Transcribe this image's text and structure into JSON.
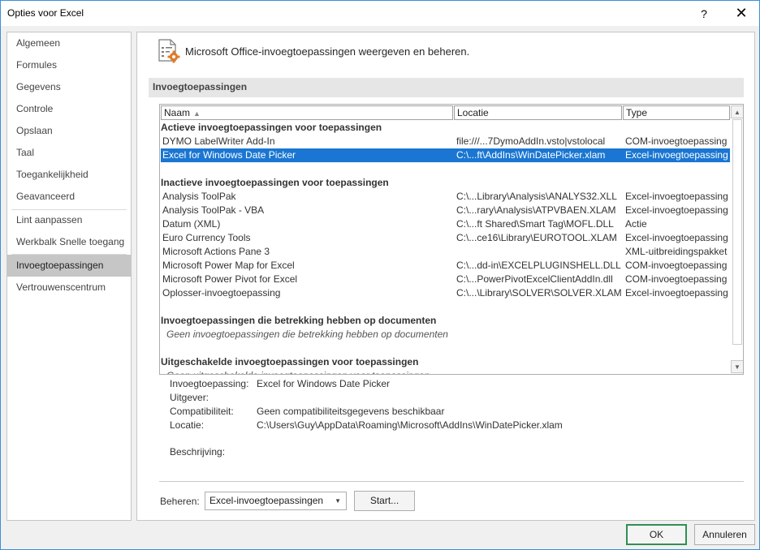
{
  "window": {
    "title": "Opties voor Excel",
    "help_glyph": "?",
    "close_glyph": "✕"
  },
  "nav": {
    "items": [
      {
        "label": "Algemeen"
      },
      {
        "label": "Formules"
      },
      {
        "label": "Gegevens"
      },
      {
        "label": "Controle"
      },
      {
        "label": "Opslaan"
      },
      {
        "label": "Taal"
      },
      {
        "label": "Toegankelijkheid"
      },
      {
        "label": "Geavanceerd"
      },
      {
        "label": "Lint aanpassen"
      },
      {
        "label": "Werkbalk Snelle toegang"
      },
      {
        "label": "Invoegtoepassingen",
        "selected": true
      },
      {
        "label": "Vertrouwenscentrum"
      }
    ]
  },
  "content": {
    "header_icon": "addins-gear-icon",
    "header_text": "Microsoft Office-invoegtoepassingen weergeven en beheren.",
    "section_title": "Invoegtoepassingen"
  },
  "list": {
    "columns": {
      "name": "Naam",
      "name_sort": "▲",
      "location": "Locatie",
      "type": "Type"
    },
    "rows": [
      {
        "kind": "group",
        "name": "Actieve invoegtoepassingen voor toepassingen"
      },
      {
        "kind": "item",
        "name": "DYMO LabelWriter Add-In",
        "location": "file:///...7DymoAddIn.vsto|vstolocal",
        "type": "COM-invoegtoepassing"
      },
      {
        "kind": "item",
        "name": "Excel for Windows Date Picker",
        "location": "C:\\...ft\\AddIns\\WinDatePicker.xlam",
        "type": "Excel-invoegtoepassing",
        "selected": true
      },
      {
        "kind": "spacer"
      },
      {
        "kind": "group",
        "name": "Inactieve invoegtoepassingen voor toepassingen"
      },
      {
        "kind": "item",
        "name": "Analysis ToolPak",
        "location": "C:\\...Library\\Analysis\\ANALYS32.XLL",
        "type": "Excel-invoegtoepassing"
      },
      {
        "kind": "item",
        "name": "Analysis ToolPak - VBA",
        "location": "C:\\...rary\\Analysis\\ATPVBAEN.XLAM",
        "type": "Excel-invoegtoepassing"
      },
      {
        "kind": "item",
        "name": "Datum (XML)",
        "location": "C:\\...ft Shared\\Smart Tag\\MOFL.DLL",
        "type": "Actie"
      },
      {
        "kind": "item",
        "name": "Euro Currency Tools",
        "location": "C:\\...ce16\\Library\\EUROTOOL.XLAM",
        "type": "Excel-invoegtoepassing"
      },
      {
        "kind": "item",
        "name": "Microsoft Actions Pane 3",
        "location": "",
        "type": "XML-uitbreidingspakket"
      },
      {
        "kind": "item",
        "name": "Microsoft Power Map for Excel",
        "location": "C:\\...dd-in\\EXCELPLUGINSHELL.DLL",
        "type": "COM-invoegtoepassing"
      },
      {
        "kind": "item",
        "name": "Microsoft Power Pivot for Excel",
        "location": "C:\\...PowerPivotExcelClientAddIn.dll",
        "type": "COM-invoegtoepassing"
      },
      {
        "kind": "item",
        "name": "Oplosser-invoegtoepassing",
        "location": "C:\\...\\Library\\SOLVER\\SOLVER.XLAM",
        "type": "Excel-invoegtoepassing"
      },
      {
        "kind": "spacer"
      },
      {
        "kind": "group",
        "name": "Invoegtoepassingen die betrekking hebben op documenten"
      },
      {
        "kind": "note",
        "name": "Geen invoegtoepassingen die betrekking hebben op documenten"
      },
      {
        "kind": "spacer"
      },
      {
        "kind": "group",
        "name": "Uitgeschakelde invoegtoepassingen voor toepassingen"
      },
      {
        "kind": "clipped",
        "name": "Geen uitgeschakelde invoegtoepassingen voor toepassingen"
      }
    ]
  },
  "details": {
    "addin_label": "Invoegtoepassing:",
    "addin_value": "Excel for Windows Date Picker",
    "publisher_label": "Uitgever:",
    "publisher_value": "",
    "compat_label": "Compatibiliteit:",
    "compat_value": "Geen compatibiliteitsgegevens beschikbaar",
    "location_label": "Locatie:",
    "location_value": "C:\\Users\\Guy\\AppData\\Roaming\\Microsoft\\AddIns\\WinDatePicker.xlam",
    "description_label": "Beschrijving:",
    "description_value": ""
  },
  "manage": {
    "label": "Beheren:",
    "selected": "Excel-invoegtoepassingen",
    "start_button": "Start..."
  },
  "footer": {
    "ok": "OK",
    "cancel": "Annuleren"
  },
  "colors": {
    "selection": "#1a76d2",
    "ok_border": "#2f8f55",
    "nav_selected": "#c6c6c6",
    "icon_orange": "#e07b2a"
  }
}
